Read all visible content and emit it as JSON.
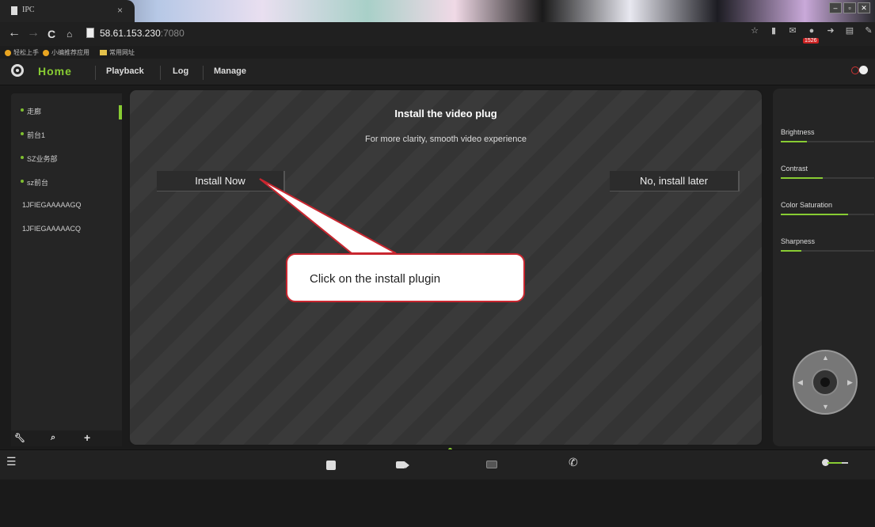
{
  "browser": {
    "tab_title": "IPC",
    "tab_close": "×",
    "url_host": "58.61.153.230",
    "url_port": ":7080",
    "bookmarks": [
      "轻松上手",
      "小编推荐应用",
      "常用网址"
    ],
    "download_badge": "1526"
  },
  "app": {
    "nav": {
      "home": "Home",
      "playback": "Playback",
      "log": "Log",
      "manage": "Manage"
    }
  },
  "devices": [
    {
      "name": "走廊",
      "online": true
    },
    {
      "name": "前台1",
      "online": true
    },
    {
      "name": "SZ业务部",
      "online": true
    },
    {
      "name": "sz前台",
      "online": true
    },
    {
      "name": "1JFIEGAAAAAGQ",
      "online": false
    },
    {
      "name": "1JFIEGAAAAACQ",
      "online": false
    }
  ],
  "plugin_prompt": {
    "title": "Install the video plug",
    "subtitle": "For more clarity, smooth video experience",
    "install_label": "Install Now",
    "later_label": "No, install later"
  },
  "annotation": {
    "text": "Click on the install plugin"
  },
  "image_settings": {
    "brightness_label": "Brightness",
    "brightness_value": 0.28,
    "contrast_label": "Contrast",
    "contrast_value": 0.45,
    "saturation_label": "Color Saturation",
    "saturation_value": 0.72,
    "sharpness_label": "Sharpness",
    "sharpness_value": 0.22
  },
  "colors": {
    "accent": "#88cc33",
    "callout_border": "#c8262f"
  },
  "icons": {
    "bottom": [
      "stop-icon",
      "record-icon",
      "snapshot-icon",
      "talk-icon"
    ],
    "left_tools": [
      "wrench-icon",
      "zoom-icon",
      "add-icon"
    ],
    "ptz": "ptz-dpad-icon"
  }
}
